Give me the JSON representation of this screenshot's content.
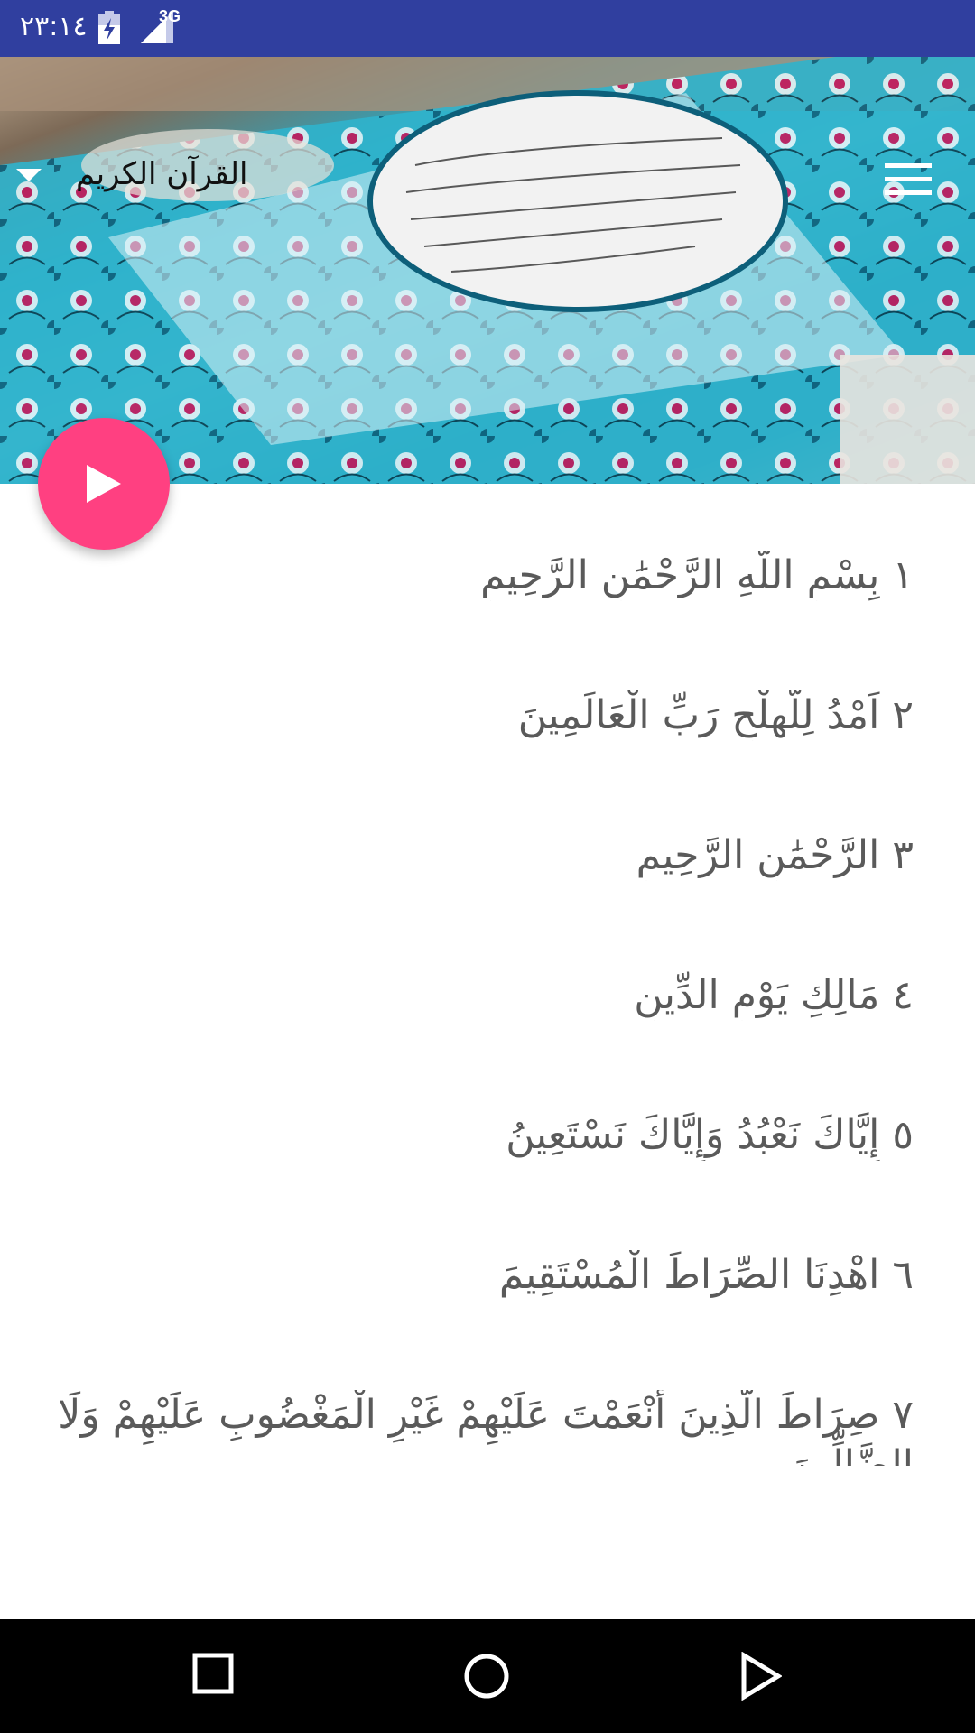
{
  "status_bar": {
    "time": "٢٣:١٤",
    "network": "3G",
    "icons": [
      "battery-charging-icon",
      "signal-icon"
    ]
  },
  "toolbar": {
    "title": "القرآن الكريم",
    "icons": [
      "dropdown-arrow-icon",
      "hamburger-menu-icon"
    ]
  },
  "fab": {
    "icon": "play-icon",
    "color": "#ff4081"
  },
  "verses": [
    {
      "number": "١",
      "text": "بِسْمِ اللَّهِ الرَّحْمَٰنِ الرَّحِيمِ"
    },
    {
      "number": "٢",
      "text": "اَمْدُ لِلَّهلْحِ رَبِّ الْعَالَمِينَ"
    },
    {
      "number": "٣",
      "text": "الرَّحْمَٰنِ الرَّحِيمِ"
    },
    {
      "number": "٤",
      "text": "مَالِكِ يَوْمِ الدِّينِ"
    },
    {
      "number": "٥",
      "text": "إِيَّاكَ نَعْبُدُ وَإِيَّاكَ نَسْتَعِينُ"
    },
    {
      "number": "٦",
      "text": "اهْدِنَا الصِّرَاطَ الْمُسْتَقِيمَ"
    },
    {
      "number": "٧",
      "text": "صِرَاطَ الَّذِينَ أَنْعَمْتَ عَلَيْهِمْ غَيْرِ الْمَغْضُوبِ عَلَيْهِمْ وَلَا الضَّالِّينَ"
    }
  ],
  "nav_bar": {
    "icons": [
      "recents-square-icon",
      "home-circle-icon",
      "back-triangle-icon"
    ]
  },
  "colors": {
    "status_bar": "#303f9f",
    "fab": "#ff4081",
    "verse_text": "#5a5a5a",
    "nav_bar": "#000000"
  }
}
